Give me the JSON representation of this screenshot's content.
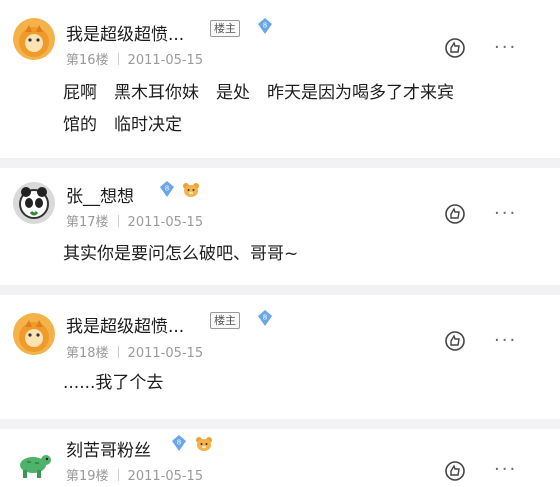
{
  "posts": [
    {
      "username": "我是超级超愤...",
      "host_badge": "楼主",
      "level": "8",
      "floor": "第16楼",
      "date": "2011-05-15",
      "content_lines": [
        "屁啊　黑木耳你妹　是处　昨天是因为喝多了才来宾",
        "馆的　临时决定"
      ],
      "more": "···"
    },
    {
      "username": "张__想想",
      "level": "8",
      "floor": "第17楼",
      "date": "2011-05-15",
      "content_lines": [
        "其实你是要问怎么破吧、哥哥~"
      ],
      "more": "···"
    },
    {
      "username": "我是超级超愤...",
      "host_badge": "楼主",
      "level": "8",
      "floor": "第18楼",
      "date": "2011-05-15",
      "content_lines": [
        "......我了个去"
      ],
      "more": "···"
    },
    {
      "username": "刻苦哥粉丝",
      "level": "8",
      "floor": "第19楼",
      "date": "2011-05-15",
      "more": "···"
    }
  ],
  "colors": {
    "level_badge": "#6aa6ee",
    "avatar_orange": "#f0a233",
    "separator": "#f2f2f4"
  },
  "icons": [
    "diamond-level-icon",
    "bear-face-icon",
    "thumb-up-icon",
    "more-dots-icon"
  ]
}
